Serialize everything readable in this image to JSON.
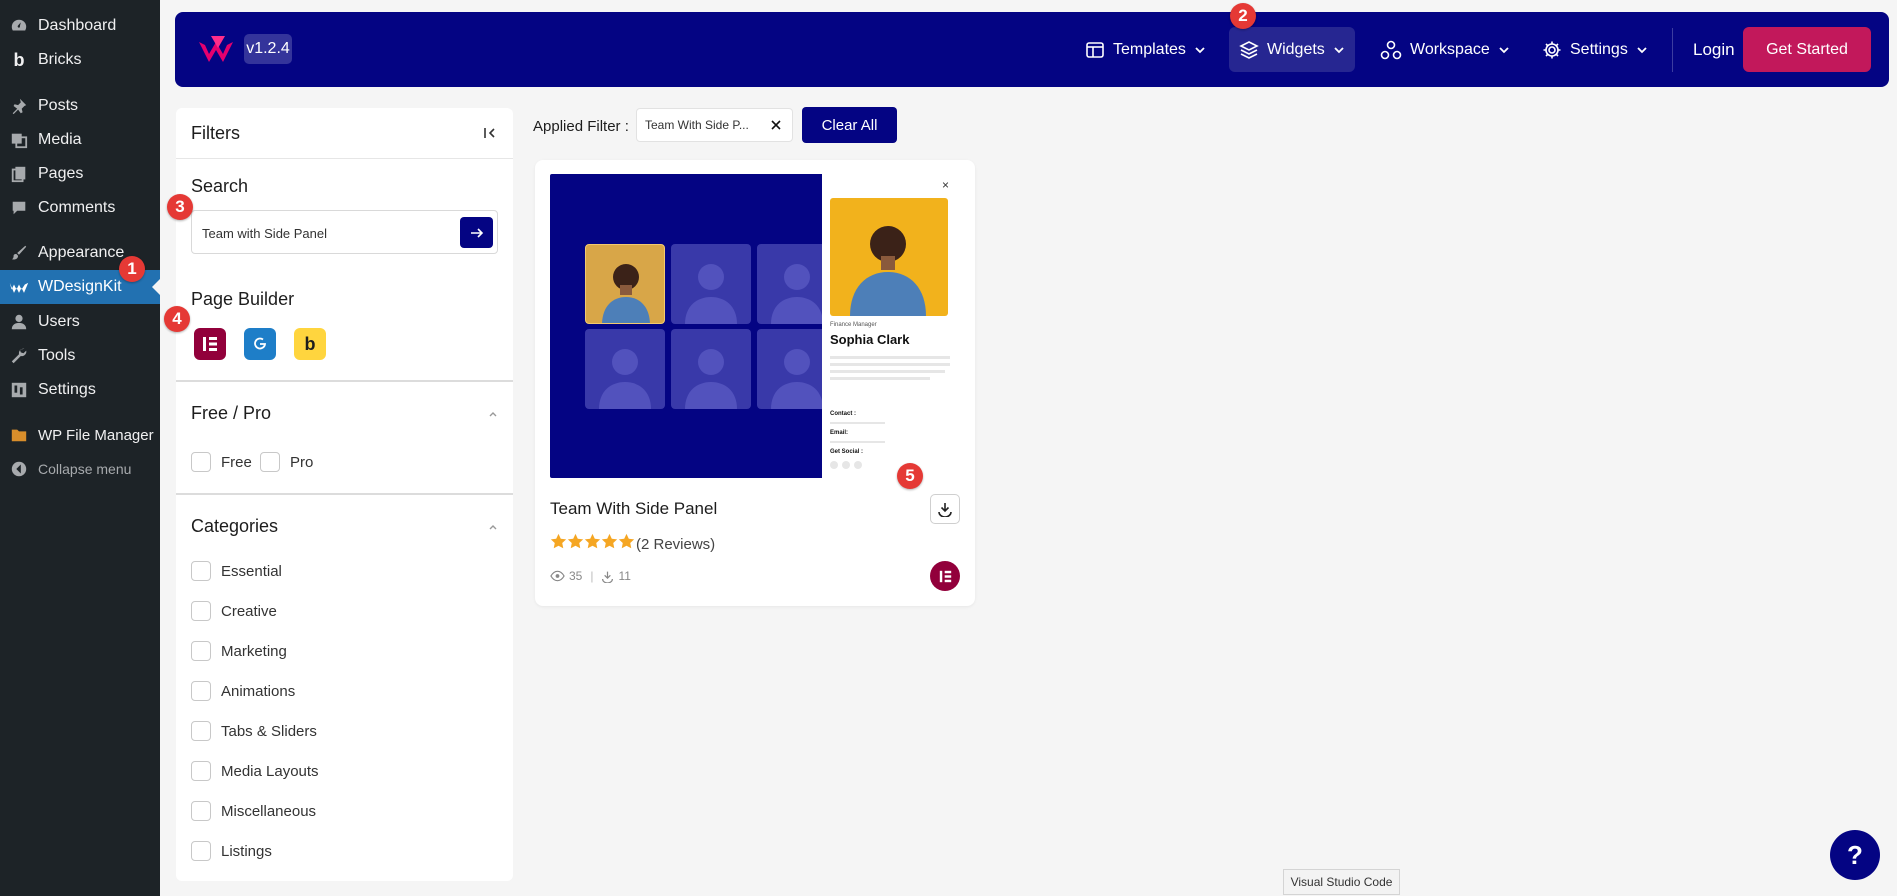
{
  "wp_menu": {
    "items": [
      {
        "label": "Dashboard",
        "icon": "dashboard-icon"
      },
      {
        "label": "Bricks",
        "icon": "bricks-icon"
      },
      {
        "label": "Posts",
        "icon": "pin-icon"
      },
      {
        "label": "Media",
        "icon": "media-icon"
      },
      {
        "label": "Pages",
        "icon": "pages-icon"
      },
      {
        "label": "Comments",
        "icon": "comment-icon"
      },
      {
        "label": "Appearance",
        "icon": "brush-icon"
      },
      {
        "label": "WDesignKit",
        "icon": "wdesignkit-icon",
        "active": true
      },
      {
        "label": "Users",
        "icon": "user-icon"
      },
      {
        "label": "Tools",
        "icon": "wrench-icon"
      },
      {
        "label": "Settings",
        "icon": "settings-icon"
      },
      {
        "label": "WP File Manager",
        "icon": "folder-icon"
      },
      {
        "label": "Collapse menu",
        "icon": "collapse-icon"
      }
    ]
  },
  "header": {
    "version": "v1.2.4",
    "nav": [
      {
        "label": "Templates",
        "icon": "templates-icon"
      },
      {
        "label": "Widgets",
        "icon": "layers-icon",
        "active": true
      },
      {
        "label": "Workspace",
        "icon": "workspace-icon"
      },
      {
        "label": "Settings",
        "icon": "gear-icon"
      }
    ],
    "login": "Login",
    "get_started": "Get Started"
  },
  "filters": {
    "title": "Filters",
    "search_title": "Search",
    "search_value": "Team with Side Panel",
    "page_builder_title": "Page Builder",
    "builders": [
      "elementor-icon",
      "gutenberg-icon",
      "bricks-icon"
    ],
    "free_pro_title": "Free / Pro",
    "free_label": "Free",
    "pro_label": "Pro",
    "categories_title": "Categories",
    "categories": [
      "Essential",
      "Creative",
      "Marketing",
      "Animations",
      "Tabs & Sliders",
      "Media Layouts",
      "Miscellaneous",
      "Listings"
    ]
  },
  "applied": {
    "label": "Applied Filter :",
    "chip": "Team With Side P...",
    "clear_all": "Clear All"
  },
  "card": {
    "title": "Team With Side Panel",
    "rating": 5,
    "reviews": "(2 Reviews)",
    "views": "35",
    "downloads": "11",
    "preview": {
      "role": "Finance Manager",
      "name": "Sophia Clark",
      "contact": "Contact :",
      "email": "Email:",
      "social": "Get Social :",
      "close": "×"
    }
  },
  "markers": [
    "1",
    "2",
    "3",
    "4",
    "5"
  ],
  "tooltip": "Visual Studio Code",
  "help": "?",
  "colors": {
    "brand": "#040483",
    "accent": "#c2185b",
    "wp_sidebar": "#1d2327",
    "wp_active": "#2271b1",
    "star": "#f5a623",
    "elementor": "#92003b",
    "marker": "#e53935"
  }
}
